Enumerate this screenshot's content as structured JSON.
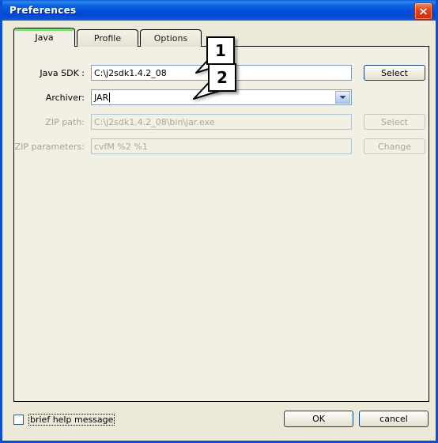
{
  "window": {
    "title": "Preferences",
    "close_icon": "close-icon"
  },
  "tabs": [
    {
      "label": "Java",
      "active": true
    },
    {
      "label": "Profile",
      "active": false
    },
    {
      "label": "Options",
      "active": false
    }
  ],
  "form": {
    "java_sdk": {
      "label": "Java SDK :",
      "value": "C:\\j2sdk1.4.2_08",
      "button": "Select",
      "disabled": false
    },
    "archiver": {
      "label": "Archiver:",
      "value": "JAR",
      "dropdown_icon": "chevron-down-icon",
      "disabled": false
    },
    "zip_path": {
      "label": "ZIP path:",
      "value": "C:\\j2sdk1.4.2_08\\bin\\jar.exe",
      "button": "Select",
      "disabled": true
    },
    "zip_parameters": {
      "label": "ZIP parameters:",
      "value": "cvfM %2 %1",
      "button": "Change",
      "disabled": true
    }
  },
  "callouts": [
    {
      "number": "1"
    },
    {
      "number": "2"
    }
  ],
  "footer": {
    "checkbox_label": "brief help message",
    "checkbox_checked": false,
    "ok_label": "OK",
    "cancel_label": "cancel"
  },
  "colors": {
    "titlebar_blue": "#0a50d2",
    "panel_bg": "#f2efe4",
    "active_tab_accent": "#7ddc6e",
    "close_red": "#c82c0c",
    "field_border": "#7f9db9"
  }
}
